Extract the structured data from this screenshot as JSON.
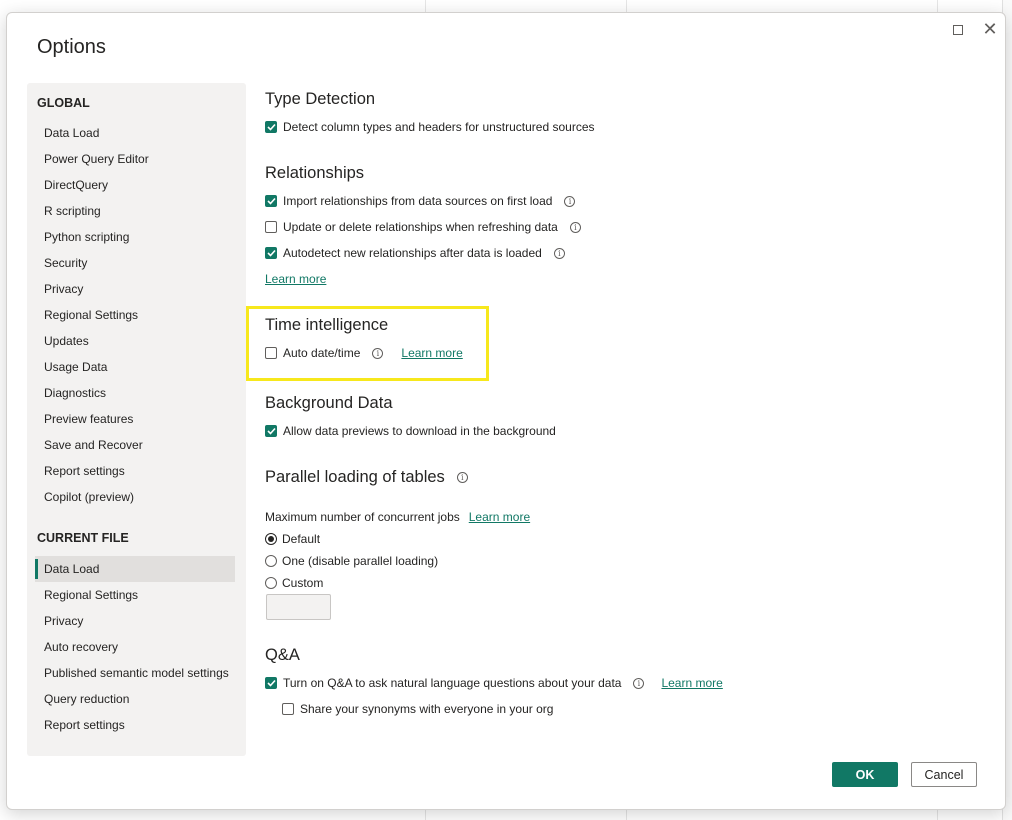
{
  "dialog": {
    "title": "Options"
  },
  "sidebar": {
    "global_heading": "GLOBAL",
    "global_items": [
      "Data Load",
      "Power Query Editor",
      "DirectQuery",
      "R scripting",
      "Python scripting",
      "Security",
      "Privacy",
      "Regional Settings",
      "Updates",
      "Usage Data",
      "Diagnostics",
      "Preview features",
      "Save and Recover",
      "Report settings",
      "Copilot (preview)"
    ],
    "current_heading": "CURRENT FILE",
    "current_items": [
      "Data Load",
      "Regional Settings",
      "Privacy",
      "Auto recovery",
      "Published semantic model settings",
      "Query reduction",
      "Report settings"
    ],
    "selected_item": "Data Load"
  },
  "type_detection": {
    "title": "Type Detection",
    "detect_label": "Detect column types and headers for unstructured sources",
    "detect_checked": true
  },
  "relationships": {
    "title": "Relationships",
    "import_label": "Import relationships from data sources on first load",
    "import_checked": true,
    "update_label": "Update or delete relationships when refreshing data",
    "update_checked": false,
    "autodetect_label": "Autodetect new relationships after data is loaded",
    "autodetect_checked": true,
    "learn_more": "Learn more"
  },
  "time_intelligence": {
    "title": "Time intelligence",
    "auto_date_label": "Auto date/time",
    "auto_date_checked": false,
    "learn_more": "Learn more",
    "highlight_color": "#f7e81c"
  },
  "background_data": {
    "title": "Background Data",
    "allow_label": "Allow data previews to download in the background",
    "allow_checked": true
  },
  "parallel_loading": {
    "title": "Parallel loading of tables",
    "max_jobs_label": "Maximum number of concurrent jobs",
    "learn_more": "Learn more",
    "options": [
      "Default",
      "One (disable parallel loading)",
      "Custom"
    ],
    "selected": "Default",
    "custom_value": ""
  },
  "qna": {
    "title": "Q&A",
    "turn_on_label": "Turn on Q&A to ask natural language questions about your data",
    "turn_on_checked": true,
    "learn_more": "Learn more",
    "share_label": "Share your synonyms with everyone in your org",
    "share_checked": false
  },
  "buttons": {
    "ok": "OK",
    "cancel": "Cancel"
  },
  "colors": {
    "accent": "#117865",
    "highlight": "#f7e81c"
  }
}
